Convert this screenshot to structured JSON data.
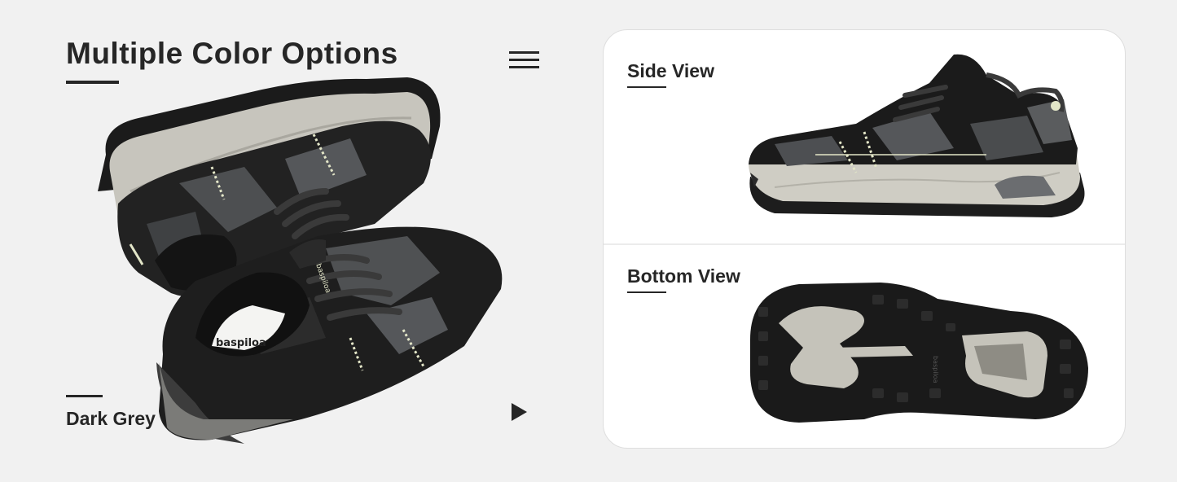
{
  "hero": {
    "title": "Multiple Color Options",
    "color_name": "Dark Grey"
  },
  "icons": {
    "menu": "hamburger-menu-icon",
    "next": "play-triangle-icon"
  },
  "views": {
    "side_label": "Side View",
    "bottom_label": "Bottom View"
  },
  "insole_logo": "baspiloa",
  "colors": {
    "background": "#f1f1f1",
    "text": "#262626",
    "card": "#ffffff",
    "shoe_dark": "#1c1c1c",
    "shoe_grey": "#5a5c5e",
    "sole_light": "#c7c5bd",
    "accent_cream": "#e3e6c8"
  }
}
